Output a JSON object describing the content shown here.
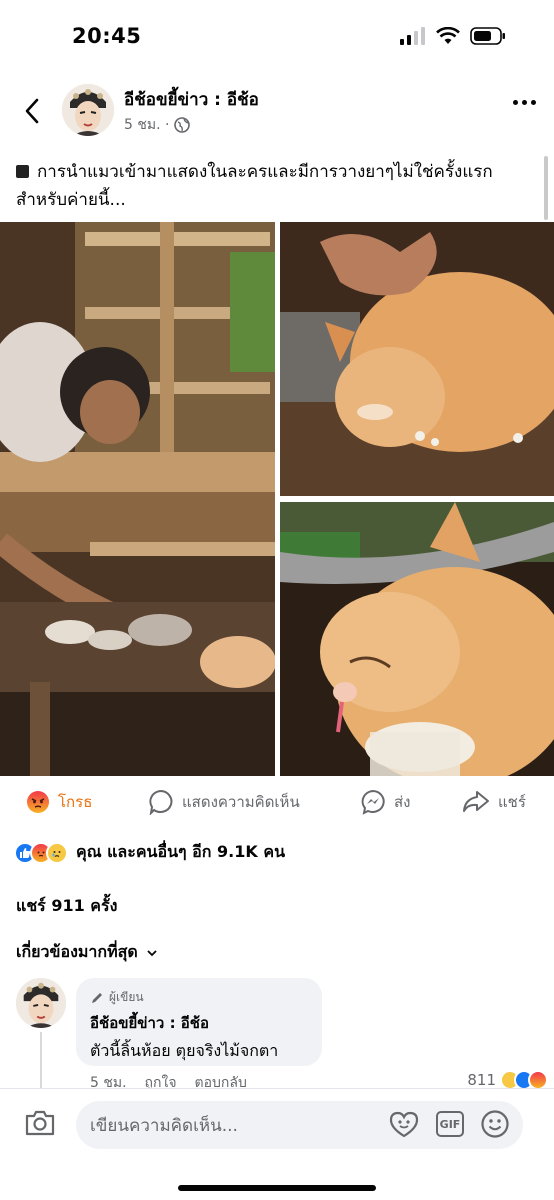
{
  "status_bar": {
    "time": "20:45"
  },
  "header": {
    "page_name": "อีช้อขยี้ข่าว : อีช้อ",
    "time_ago": "5 ชม. ·",
    "icons": [
      "back-arrow-icon",
      "globe-icon",
      "more-icon"
    ]
  },
  "post": {
    "text": "การนำแมวเข้ามาแสดงในละครและมีการวางยาๆไม่ใช่ครั้งแรกสำหรับค่ายนี้..."
  },
  "actions": {
    "react_label": "โกรธ",
    "comment_label": "แสดงความคิดเห็น",
    "send_label": "ส่ง",
    "share_label": "แชร์"
  },
  "reactions": {
    "summary": "คุณ และคนอื่นๆ อีก 9.1K คน",
    "types": [
      "like",
      "angry",
      "sad"
    ]
  },
  "shares": "แชร์ 911 ครั้ง",
  "sort_label": "เกี่ยวข้องมากที่สุด",
  "comment": {
    "badge": "ผู้เขียน",
    "author": "อีช้อขยี้ข่าว : อีช้อ",
    "text": "ตัวนี้ลิ้นห้อย ตุยจริงไม้จกตา",
    "time": "5 ชม.",
    "like_label": "ถูกใจ",
    "reply_label": "ตอบกลับ",
    "reaction_count": "811"
  },
  "composer": {
    "placeholder": "เขียนความคิดเห็น..."
  },
  "colors": {
    "accent": "#1877f2",
    "angry": "#e9710f",
    "muted": "#65676b",
    "bubble": "#f0f2f5"
  }
}
